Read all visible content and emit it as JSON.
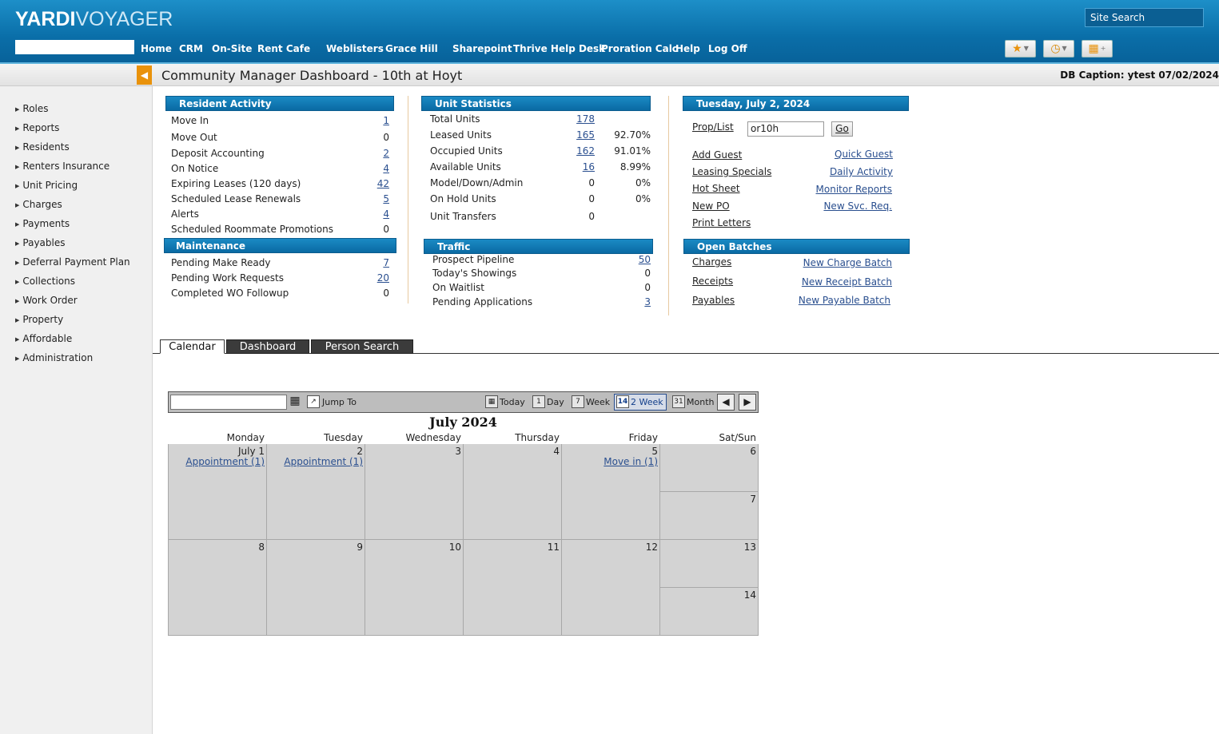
{
  "header": {
    "logo_bold": "YARDI",
    "logo_light": "VOYAGER",
    "site_search": "Site Search",
    "nav": [
      "Home",
      "CRM",
      "On-Site",
      "Rent Cafe",
      "Weblisters",
      "Grace Hill",
      "Sharepoint",
      "Thrive Help Desk",
      "Proration Calc",
      "Help",
      "Log Off"
    ]
  },
  "titlebar": {
    "title": "Community Manager Dashboard - 10th at Hoyt",
    "db_caption": "DB Caption: ytest 07/02/2024"
  },
  "sidebar": {
    "items": [
      "Roles",
      "Reports",
      "Residents",
      "Renters Insurance",
      "Unit Pricing",
      "Charges",
      "Payments",
      "Payables",
      "Deferral Payment Plan",
      "Collections",
      "Work Order",
      "Property",
      "Affordable",
      "Administration"
    ]
  },
  "resident_activity": {
    "title": "Resident Activity",
    "rows": [
      {
        "label": "Move In",
        "value": "1"
      },
      {
        "label": "Move Out",
        "value": "0"
      },
      {
        "label": "Deposit Accounting",
        "value": "2"
      },
      {
        "label": "On Notice",
        "value": "4"
      },
      {
        "label": "Expiring Leases (120 days)",
        "value": "42"
      },
      {
        "label": "Scheduled Lease Renewals",
        "value": "5"
      },
      {
        "label": "Alerts",
        "value": "4"
      },
      {
        "label": "Scheduled Roommate Promotions",
        "value": "0"
      }
    ]
  },
  "maintenance": {
    "title": "Maintenance",
    "rows": [
      {
        "label": "Pending Make Ready",
        "value": "7"
      },
      {
        "label": "Pending Work Requests",
        "value": "20"
      },
      {
        "label": "Completed WO Followup",
        "value": "0"
      }
    ]
  },
  "unit_statistics": {
    "title": "Unit Statistics",
    "rows": [
      {
        "label": "Total Units",
        "value": "178",
        "pct": ""
      },
      {
        "label": "Leased Units",
        "value": "165",
        "pct": "92.70%"
      },
      {
        "label": "Occupied Units",
        "value": "162",
        "pct": "91.01%"
      },
      {
        "label": "Available Units",
        "value": "16",
        "pct": "8.99%"
      },
      {
        "label": "Model/Down/Admin",
        "value": "0",
        "pct": "0%"
      },
      {
        "label": "On Hold Units",
        "value": "0",
        "pct": "0%"
      },
      {
        "label": "Unit Transfers",
        "value": "0",
        "pct": ""
      }
    ]
  },
  "traffic": {
    "title": "Traffic",
    "rows": [
      {
        "label": "Prospect Pipeline",
        "value": "50"
      },
      {
        "label": "Today's Showings",
        "value": "0"
      },
      {
        "label": "On Waitlist",
        "value": "0"
      },
      {
        "label": "Pending Applications",
        "value": "3"
      }
    ]
  },
  "quick": {
    "date_title": "Tuesday, July 2, 2024",
    "prop_label": "Prop/List",
    "prop_value": "or10h",
    "go": "Go",
    "links_left": [
      "Add Guest",
      "Leasing Specials",
      "Hot Sheet",
      "New PO",
      "Print Letters"
    ],
    "links_right": [
      "Quick Guest",
      "Daily Activity",
      "Monitor Reports",
      "New Svc. Req."
    ]
  },
  "open_batches": {
    "title": "Open Batches",
    "left": [
      "Charges",
      "Receipts",
      "Payables"
    ],
    "right": [
      "New Charge Batch",
      "New Receipt Batch",
      "New Payable Batch"
    ]
  },
  "tabs": [
    "Calendar",
    "Dashboard",
    "Person Search"
  ],
  "calendar": {
    "toolbar": {
      "jump_to": "Jump To",
      "today": "Today",
      "day": "Day",
      "week": "Week",
      "two_week": "2 Week",
      "month": "Month"
    },
    "month_title": "July 2024",
    "days": [
      "Monday",
      "Tuesday",
      "Wednesday",
      "Thursday",
      "Friday",
      "Sat/Sun"
    ],
    "week1": {
      "mon": "July 1",
      "tue": "2",
      "wed": "3",
      "thu": "4",
      "fri": "5",
      "sat": "6",
      "sun": "7",
      "mon_event": "Appointment (1)",
      "tue_event": "Appointment (1)",
      "fri_event": "Move in (1)"
    },
    "week2": {
      "mon": "8",
      "tue": "9",
      "wed": "10",
      "thu": "11",
      "fri": "12",
      "sat": "13",
      "sun": "14"
    }
  }
}
